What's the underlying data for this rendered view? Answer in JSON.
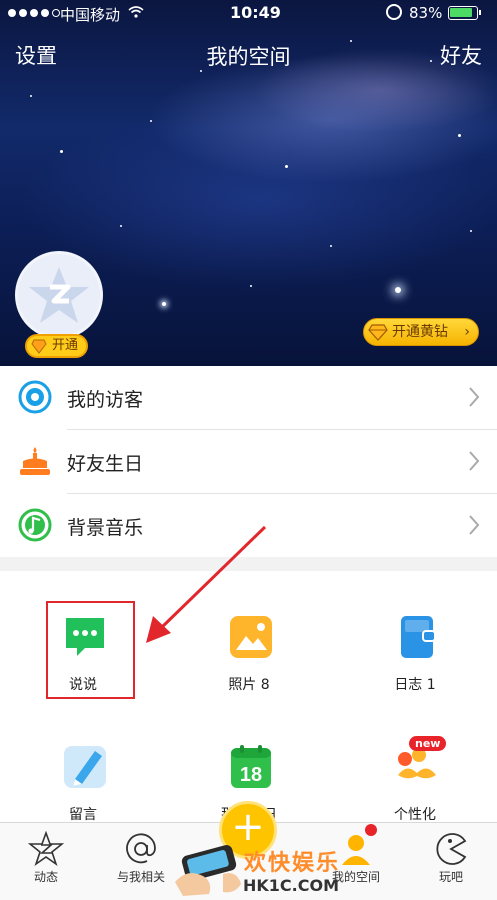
{
  "status_bar": {
    "carrier": "中国移动",
    "time": "10:49",
    "battery": "83%",
    "battery_level": 0.83
  },
  "nav": {
    "left": "设置",
    "title": "我的空间",
    "right": "好友"
  },
  "cover": {
    "avatar_badge": "开通",
    "vip_button": "开通黄钻"
  },
  "list": {
    "items": [
      {
        "label": "我的访客",
        "icon": "visitor-eye-icon",
        "color": "#1aa0e6"
      },
      {
        "label": "好友生日",
        "icon": "birthday-cake-icon",
        "color": "#ff7d1f"
      },
      {
        "label": "背景音乐",
        "icon": "music-note-icon",
        "color": "#2fbf4a"
      }
    ]
  },
  "grid": {
    "items": [
      {
        "label": "说说",
        "icon": "chat-bubble-icon",
        "color": "#22c05b"
      },
      {
        "label": "照片 8",
        "icon": "photo-icon",
        "color": "#ffb52b"
      },
      {
        "label": "日志 1",
        "icon": "journal-icon",
        "color": "#2b93e6"
      },
      {
        "label": "留言",
        "icon": "pen-icon",
        "color": "#4fb8ef"
      },
      {
        "label": "那年今日",
        "icon": "calendar-icon",
        "color": "#2fbf4a",
        "calendar_day": "18"
      },
      {
        "label": "个性化",
        "icon": "mustache-icon",
        "color": "#ff7d1f",
        "badge": "new"
      }
    ]
  },
  "tabbar": {
    "items": [
      {
        "label": "动态",
        "icon": "qzone-star-icon"
      },
      {
        "label": "与我相关",
        "icon": "at-sign-icon"
      },
      {
        "label": "我的空间",
        "icon": "profile-person-icon",
        "active": true
      },
      {
        "label": "玩吧",
        "icon": "pacman-game-icon"
      }
    ],
    "fab": "+"
  },
  "watermark": {
    "text": "欢快娱乐",
    "url": "HK1C.COM"
  }
}
